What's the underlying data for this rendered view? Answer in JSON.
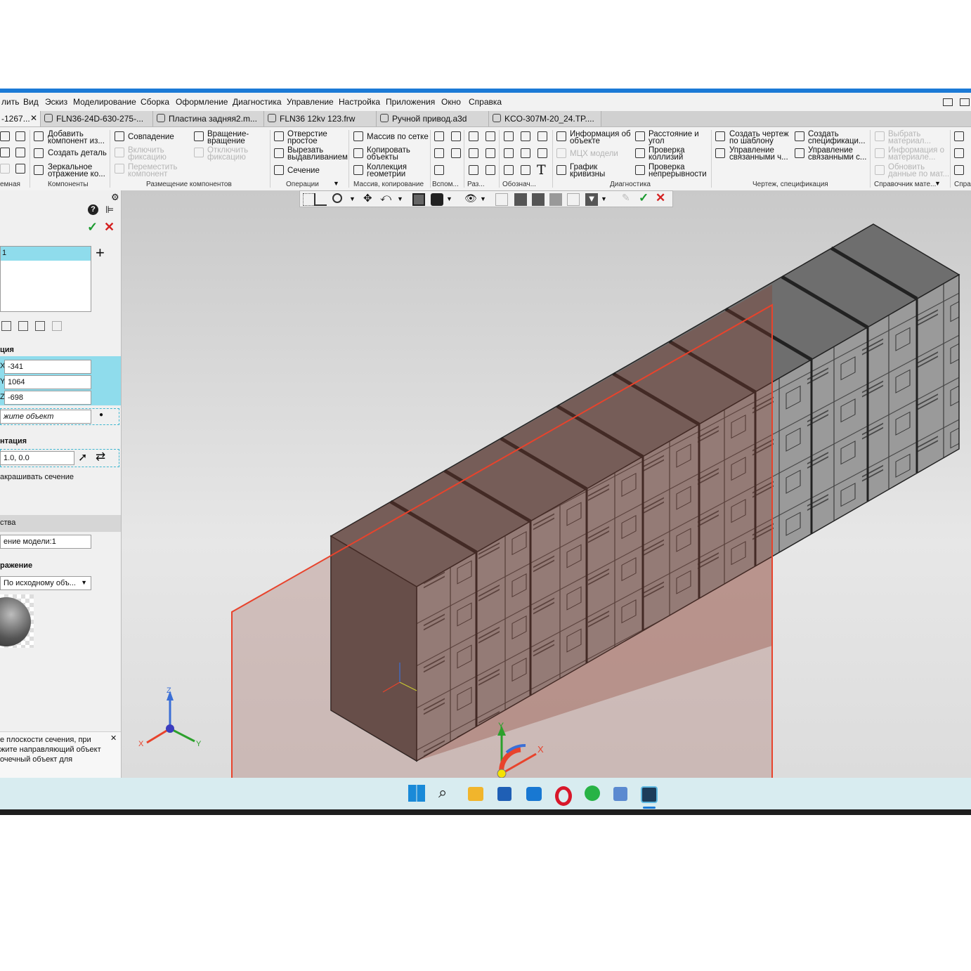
{
  "menu": [
    "лить",
    "Вид",
    "Эскиз",
    "Моделирование",
    "Сборка",
    "Оформление",
    "Диагностика",
    "Управление",
    "Настройка",
    "Приложения",
    "Окно",
    "Справка"
  ],
  "tabs": [
    {
      "label": "-1267...",
      "active": true,
      "close": "✕"
    },
    {
      "label": "FLN36-24D-630-275-..."
    },
    {
      "label": "Пластина задняя2.m..."
    },
    {
      "label": "FLN36 12kv 123.frw"
    },
    {
      "label": "Ручной привод.a3d"
    },
    {
      "label": "KCO-307M-20_24.TP...."
    }
  ],
  "ribbon": {
    "add_component": "Добавить\nкомпонент из...",
    "create_part": "Создать деталь",
    "mirror": "Зеркальное\nотражение ко...",
    "coincidence": "Совпадение",
    "enable_fix": "Включить\nфиксацию",
    "move_component": "Переместить\nкомпонент",
    "rotation": "Вращение-\nвращение",
    "disable_fix": "Отключить\nфиксацию",
    "hole_simple": "Отверстие\nпростое",
    "cut_extrude": "Вырезать\nвыдавливанием",
    "section": "Сечение",
    "pattern_grid": "Массив по сетке",
    "copy_objects": "Копировать\nобъекты",
    "geometry_collection": "Коллекция\nгеометрии",
    "object_info": "Информация об\nобъекте",
    "mcx_model": "МЦХ модели",
    "curvature_graph": "График\nкривизны",
    "distance_angle": "Расстояние и\nугол",
    "check_collisions": "Проверка\nколлизий",
    "check_continuity": "Проверка\nнепрерывности",
    "create_drawing": "Создать чертеж\nпо шаблону",
    "manage_linked_drawings": "Управление\nсвязанными ч...",
    "create_spec": "Создать\nспецификаци...",
    "manage_linked_specs": "Управление\nсвязанными с...",
    "choose_material": "Выбрать\nматериал...",
    "material_info": "Информация о\nматериале...",
    "update_material": "Обновить\nданные по мат...",
    "groups": {
      "g0": "емная",
      "components": "Компоненты",
      "placement": "Размещение компонентов",
      "operations": "Операции",
      "pattern": "Массив, копирование",
      "aux": "Вспом...",
      "dims": "Раз...",
      "notation": "Обознач...",
      "diagnostics": "Диагностика",
      "drawing_spec": "Чертеж, спецификация",
      "material_ref": "Справочник мате...",
      "ref": "Спра"
    }
  },
  "panel": {
    "list_item": "1",
    "position_label": "ция",
    "x_label": "X",
    "x_value": "-341",
    "y_label": "Y",
    "y_value": "1064",
    "z_label": "Z",
    "z_value": "-698",
    "pick_object": "жите объект",
    "orientation_label": "нтация",
    "orientation_value": "1.0, 0.0",
    "fill_section": "акрашивать сечение",
    "properties_header": "ства",
    "model_section_name": "ение модели:1",
    "display_label": "ражение",
    "display_value": "По исходному объ...",
    "hint_text": "е плоскости сечения, при\nжите направляющий объект\nочечный объект для",
    "hint_close": "✕"
  },
  "triad": {
    "x": "X",
    "y": "Y",
    "z": "Z"
  },
  "colors": {
    "accent": "#1b7ad6",
    "section_plane": "#e8432c",
    "selection": "#8fdcec",
    "ok": "#1a9a2e",
    "cancel": "#d42020",
    "taskbar": "#d8ecf0"
  },
  "taskbar_icons": [
    "windows-start-icon",
    "search-icon",
    "file-explorer-icon",
    "store-icon",
    "outlook-icon",
    "opera-icon",
    "whatsapp-icon",
    "remote-desktop-icon",
    "kompas-3d-icon"
  ]
}
